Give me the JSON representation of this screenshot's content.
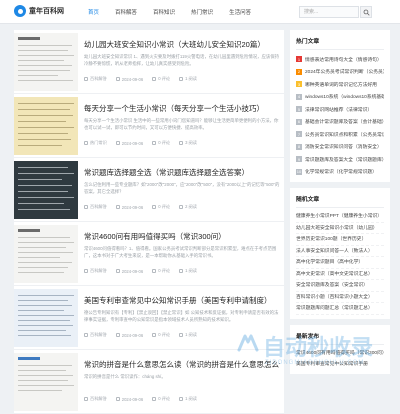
{
  "header": {
    "logo": "童年百科网",
    "nav": [
      "首页",
      "百科解答",
      "百科知识",
      "热门常识",
      "生活问答"
    ],
    "search_placeholder": "搜索..."
  },
  "articles": [
    {
      "title": "幼儿园大班安全知识小常识（大班幼儿安全知识20篇）",
      "excerpt": "幼儿园大班安全知识常识 1、遇到火灾要及时拨打119火警电话，在幼儿园里遇到危险情况，应该保持冷静不要惊慌，听从老师指挥，让幼儿真实感受到危险。",
      "category": "百科解答",
      "date": "2024-09-06",
      "views": "0 评论",
      "reads": "1 阅读",
      "thumb": "doc"
    },
    {
      "title": "每天分享一个生活小常识（每天分享一个生活小技巧）",
      "excerpt": "每天分享一个生活小常识 生活中的一些常用小窍门您知道吗？能够让生活更简单更便利的小方法，你也可以试一试，即可以节约时间，又可以方便快捷、提高效率。",
      "category": "热门常识",
      "date": "2024-09-06",
      "views": "0 评论",
      "reads": "3 阅读",
      "thumb": "yellow"
    },
    {
      "title": "常识题库选择题全选（常识题库选择题全选答案）",
      "excerpt": "怎么记住利用一些专业题库？如\"2000\"改\"2000\"，应\"2000\"改\"500\"，没有\"2000以上\"的记忆等\"500\"的答案，其它全选择？",
      "category": "百科解答",
      "date": "2024-09-06",
      "views": "0 评论",
      "reads": "2 阅读",
      "thumb": "dark"
    },
    {
      "title": "常识4600问有用吗值得买吗（常识300问）",
      "excerpt": "常识4600问值得看吗？1、值得看。国家公务员考试常识判断部分是常识积累型，难点在于考点范围广，这本书对于广大考生来说，是一本帮助你从基础入手的常识书。",
      "category": "百科解答",
      "date": "2024-09-06",
      "views": "0 评论",
      "reads": "1 阅读",
      "thumb": "doc"
    },
    {
      "title": "美国专利审查常见中公知常识手册（美国专利申请制度）",
      "excerpt": "德公告专利知识有【专利】【禁止驳回】【禁止常识】如 公知技术和反证据，对专利申请是否有效的法律事实证据，专利审查中的公知常识是指本领域技术人员所熟知的技术知识。",
      "category": "百科解答",
      "date": "2024-09-06",
      "views": "0 评论",
      "reads": "1 阅读",
      "thumb": "blue"
    },
    {
      "title": "常识的拼音是什么意思怎么读（常识的拼音是什么意思怎么读啊）",
      "excerpt": "常识的拼音是什么 常识读作：cháng shí。",
      "category": "百科解答",
      "date": "2024-09-06",
      "views": "0 评论",
      "reads": "1 阅读",
      "thumb": "doc"
    }
  ],
  "sidebar": {
    "hot_title": "热门文章",
    "hot": [
      "情感表达常用诗句大全（情感诗句）",
      "2024年公务员考试常识判断（公务员）",
      "哪种英语单词的常识记忆方法好用",
      "windows10系统（windows10系统基础）",
      "法律常识网站推荐（法律常识）",
      "基础会计常识题库及答案（会计基础）",
      "公务员常识知识点和积累（公务员常识）",
      "消防安全常识知识问答（消防安全）",
      "常识题题库及答案大全（常识题题库）",
      "化学常规常识（化学常规常识题）"
    ],
    "rec_title": "随机文章",
    "rec": [
      "健康养生小常识PPT（健康养生小常识）",
      "幼儿园大班安全知识小常识（幼儿园）",
      "世界历史常识100题（世界历史）",
      "法人事安全知识问答一人（致法人）",
      "高中化学常识题目（高中化学）",
      "高中文史常识（高中文史常识汇总）",
      "安全常识题库及答案（安全常识）",
      "百科常识小题（百科常识小题大全）",
      "常识题题库问题汇总（常识题汇总）"
    ],
    "new_title": "最新发布",
    "new": [
      "常识4600问有用吗值得买吗（常识300问）",
      "美国专利审查常见中公知常识手册"
    ]
  },
  "watermark": {
    "main": "自动秒收录",
    "sub": "ZIDONGMIAOSHOULU.COM"
  },
  "colors": {
    "accent": "#1e88e5",
    "rank1": "#e53935",
    "rank2": "#fb8c00",
    "rank3": "#fbc02d"
  }
}
